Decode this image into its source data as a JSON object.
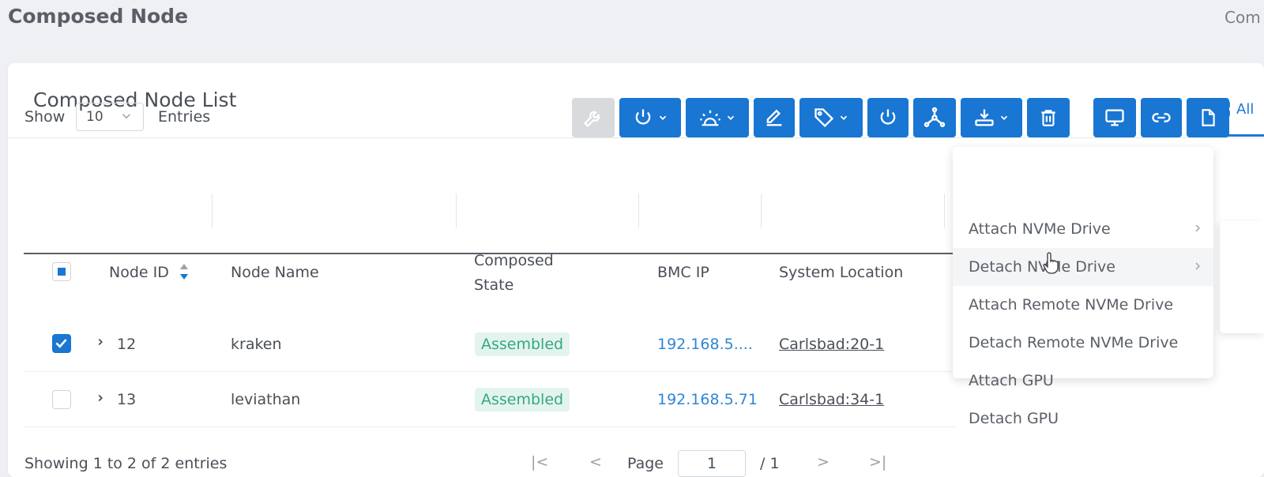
{
  "page": {
    "title": "Composed Node",
    "breadcrumb": "Com"
  },
  "card": {
    "title": "Composed Node List",
    "view_tab": "All"
  },
  "entries": {
    "show_label": "Show",
    "value": "10",
    "entries_label": "Entries"
  },
  "toolbar": {
    "buttons": [
      {
        "name": "wrench",
        "state": "disabled"
      },
      {
        "name": "power-dropdown"
      },
      {
        "name": "indicator-dropdown"
      },
      {
        "name": "edit"
      },
      {
        "name": "tag-dropdown"
      },
      {
        "name": "power"
      },
      {
        "name": "topology"
      },
      {
        "name": "drive-dropdown"
      },
      {
        "name": "delete"
      },
      {
        "name": "console"
      },
      {
        "name": "link"
      },
      {
        "name": "document"
      }
    ]
  },
  "table": {
    "columns": [
      "Node ID",
      "Node Name",
      "Composed",
      "State",
      "BMC IP",
      "System Location"
    ],
    "rows": [
      {
        "checked": true,
        "id": "12",
        "name": "kraken",
        "state": "Assembled",
        "bmc_ip": "192.168.5....",
        "location": "Carlsbad:20-1"
      },
      {
        "checked": false,
        "id": "13",
        "name": "leviathan",
        "state": "Assembled",
        "bmc_ip": "192.168.5.71",
        "location": "Carlsbad:34-1"
      }
    ]
  },
  "footer": {
    "showing": "Showing 1 to 2 of 2 entries",
    "page_label": "Page",
    "page_value": "1",
    "page_total": "/ 1"
  },
  "dropdown": {
    "items": [
      {
        "label": "Attach NVMe Drive",
        "submenu": true
      },
      {
        "label": "Detach NVMe Drive",
        "submenu": true,
        "hover": true
      },
      {
        "label": "Attach Remote NVMe Drive",
        "submenu": false
      },
      {
        "label": "Detach Remote NVMe Drive",
        "submenu": false
      },
      {
        "label": "Attach GPU",
        "submenu": false
      },
      {
        "label": "Detach GPU",
        "submenu": false
      }
    ]
  },
  "colors": {
    "primary": "#1976d2",
    "badge_bg": "#e3f4ee",
    "badge_text": "#35a882",
    "link": "#2f86d6"
  }
}
